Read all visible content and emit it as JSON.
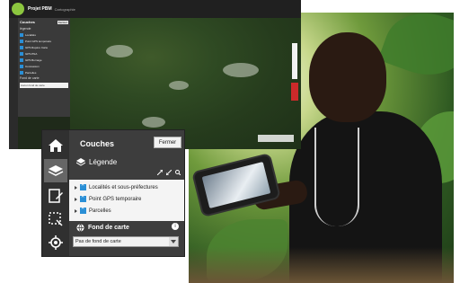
{
  "map_app": {
    "title": "Projet PBM",
    "subtitle": "Cartographie",
    "panel_header": "Couches",
    "panel_close": "Fermer",
    "legend_label": "légende",
    "layers": [
      "Localités",
      "Point GPS temporaire",
      "GPS Repère Carte",
      "GPS PNA",
      "GPS Bornage",
      "Concession",
      "Parcelles"
    ],
    "basemap_label": "Fond de carte",
    "basemap_value": "Aucun fond de carte"
  },
  "panel": {
    "title": "Couches",
    "close_label": "Fermer",
    "legend_label": "Légende",
    "layers": [
      {
        "label": "Localités et sous-préfectures"
      },
      {
        "label": "Point GPS temporaire"
      },
      {
        "label": "Parcelles"
      }
    ],
    "basemap_label": "Fond de carte",
    "basemap_select": "Pas de fond de carte",
    "info_icon": "i"
  },
  "icons": {
    "home": "home-icon",
    "layers": "layers-icon",
    "edit": "edit-icon",
    "select": "select-area-icon",
    "locate": "locate-icon"
  },
  "colors": {
    "checkbox_blue": "#2a8fd6",
    "panel_dark": "#3d3d3d",
    "map_green": "#2f4a23"
  }
}
